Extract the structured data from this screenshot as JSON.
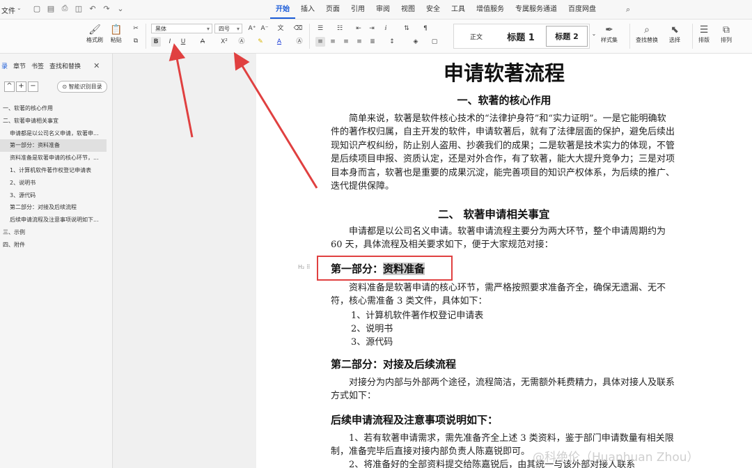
{
  "topbar": {
    "file_menu": "文件",
    "tabs": [
      "开始",
      "插入",
      "页面",
      "引用",
      "审阅",
      "视图",
      "安全",
      "工具",
      "增值服务",
      "专属服务通道",
      "百度网盘"
    ],
    "active_tab": "开始"
  },
  "ribbon": {
    "format_painter": "格式刷",
    "paste": "粘贴",
    "font_name": "黑体",
    "font_size": "四号",
    "bold": "B",
    "italic": "I",
    "underline": "U",
    "strike": "A",
    "superscript": "X²",
    "style_normal": "正文",
    "style_h1": "标题 1",
    "style_h2": "标题 2",
    "style_set": "样式集",
    "find_replace": "查找替换",
    "select": "选择",
    "layout": "排版",
    "arrange": "排列"
  },
  "nav": {
    "tabs": [
      "录",
      "章节",
      "书签",
      "查找和替换"
    ],
    "tool_up": "^",
    "tool_plus": "+",
    "tool_minus": "−",
    "smart_toc": "智能识别目录",
    "items": [
      {
        "label": "一、软著的核心作用",
        "level": 1,
        "selected": false
      },
      {
        "label": "二、软著申请相关事宜",
        "level": 1,
        "selected": false
      },
      {
        "label": "申请都是以公司名义申请，软著申...",
        "level": 2,
        "selected": false
      },
      {
        "label": "第一部分：资料准备",
        "level": 2,
        "selected": true
      },
      {
        "label": "资料准备是软著申请的核心环节，...",
        "level": 2,
        "selected": false
      },
      {
        "label": "1、计算机软件著作权登记申请表",
        "level": 2,
        "selected": false
      },
      {
        "label": "2、说明书",
        "level": 2,
        "selected": false
      },
      {
        "label": "3、源代码",
        "level": 2,
        "selected": false
      },
      {
        "label": "第二部分：对接及后续流程",
        "level": 2,
        "selected": false
      },
      {
        "label": "后续申请流程及注意事项说明如下...",
        "level": 2,
        "selected": false
      },
      {
        "label": "三、示例",
        "level": 1,
        "selected": false
      },
      {
        "label": "四、附件",
        "level": 1,
        "selected": false
      }
    ]
  },
  "doc": {
    "title": "申请软著流程",
    "h1_a": "一、软著的核心作用",
    "para_a": "简单来说，软著是软件核心技术的“法律护身符”和“实力证明”。一是它能明确软件的著作权归属，自主开发的软件，申请软著后，就有了法律层面的保护，避免后续出现知识产权纠纷，防止别人盗用、抄袭我们的成果；二是软著是技术实力的体现，不管是后续项目申报、资质认定，还是对外合作，有了软著，能大大提升竞争力；三是对项目本身而言，软著也是重要的成果沉淀，能完善项目的知识产权体系，为后续的推广、迭代提供保障。",
    "h1_b": "二、 软著申请相关事宜",
    "para_b": "申请都是以公司名义申请。软著申请流程主要分为两大环节，整个申请周期约为 60 天，具体流程及相关要求如下，便于大家规范对接：",
    "h2_a_prefix": "第一部分：",
    "h2_a_highlight": "资料准备",
    "heading_marker": "H₂ ⠿",
    "para_c": "资料准备是软著申请的核心环节，需严格按照要求准备齐全，确保无遗漏、无不符，核心需准备 3 类文件，具体如下：",
    "list": [
      "1、计算机软件著作权登记申请表",
      "2、说明书",
      "3、源代码"
    ],
    "h2_b": "第二部分：对接及后续流程",
    "para_d": "对接分为内部与外部两个途径，流程简洁，无需额外耗费精力，具体对接人及联系方式如下：",
    "h2_c": "后续申请流程及注意事项说明如下：",
    "para_e": "1、若有软著申请需求，需先准备齐全上述 3 类资料，鉴于部门申请数量有相关限制，准备完毕后直接对接内部负责人陈嘉锐即可。",
    "para_f": "2、将准备好的全部资料提交给陈嘉锐后，由其统一与该外部对接人联系"
  },
  "watermark": "@科绝伦（Huanhuan Zhou）",
  "colors": {
    "accent": "#1a5bd8",
    "annotation": "#e04040"
  }
}
